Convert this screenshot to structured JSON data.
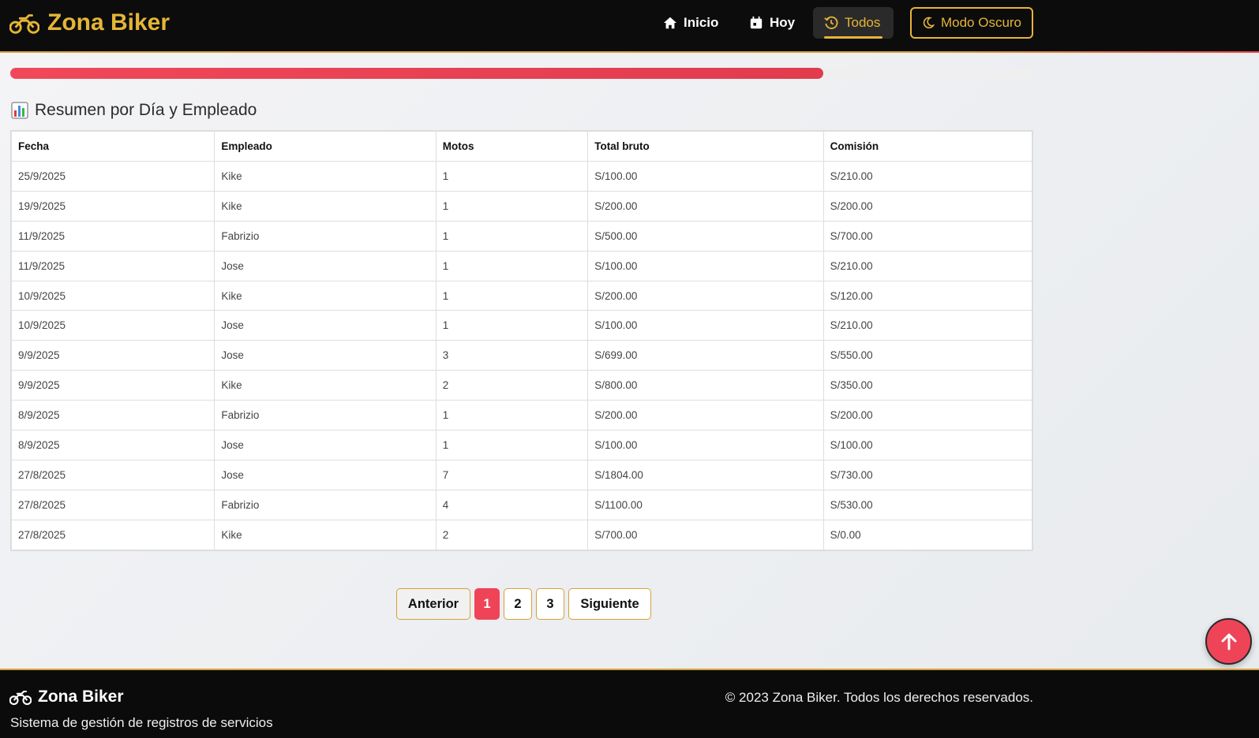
{
  "header": {
    "brand": "Zona Biker",
    "brand_icon": "motorcycle-icon",
    "nav": {
      "inicio": "Inicio",
      "hoy": "Hoy",
      "todos": "Todos"
    },
    "dark_mode": "Modo Oscuro"
  },
  "colors": {
    "brand_gold": "#e5b536",
    "accent_red": "#ef4458",
    "dark_bg": "#0c0c0c"
  },
  "progress": {
    "fraction": 0.795
  },
  "section": {
    "title": "Resumen por Día y Empleado"
  },
  "table": {
    "headers": [
      "Fecha",
      "Empleado",
      "Motos",
      "Total bruto",
      "Comisión"
    ],
    "rows": [
      [
        "25/9/2025",
        "Kike",
        "1",
        "S/100.00",
        "S/210.00"
      ],
      [
        "19/9/2025",
        "Kike",
        "1",
        "S/200.00",
        "S/200.00"
      ],
      [
        "11/9/2025",
        "Fabrizio",
        "1",
        "S/500.00",
        "S/700.00"
      ],
      [
        "11/9/2025",
        "Jose",
        "1",
        "S/100.00",
        "S/210.00"
      ],
      [
        "10/9/2025",
        "Kike",
        "1",
        "S/200.00",
        "S/120.00"
      ],
      [
        "10/9/2025",
        "Jose",
        "1",
        "S/100.00",
        "S/210.00"
      ],
      [
        "9/9/2025",
        "Jose",
        "3",
        "S/699.00",
        "S/550.00"
      ],
      [
        "9/9/2025",
        "Kike",
        "2",
        "S/800.00",
        "S/350.00"
      ],
      [
        "8/9/2025",
        "Fabrizio",
        "1",
        "S/200.00",
        "S/200.00"
      ],
      [
        "8/9/2025",
        "Jose",
        "1",
        "S/100.00",
        "S/100.00"
      ],
      [
        "27/8/2025",
        "Jose",
        "7",
        "S/1804.00",
        "S/730.00"
      ],
      [
        "27/8/2025",
        "Fabrizio",
        "4",
        "S/1100.00",
        "S/530.00"
      ],
      [
        "27/8/2025",
        "Kike",
        "2",
        "S/700.00",
        "S/0.00"
      ]
    ]
  },
  "pagination": {
    "prev": "Anterior",
    "pages": [
      "1",
      "2",
      "3"
    ],
    "active_page": "1",
    "next": "Siguiente"
  },
  "footer": {
    "brand": "Zona Biker",
    "subtitle": "Sistema de gestión de registros de servicios",
    "copyright": "© 2023 Zona Biker. Todos los derechos reservados."
  }
}
